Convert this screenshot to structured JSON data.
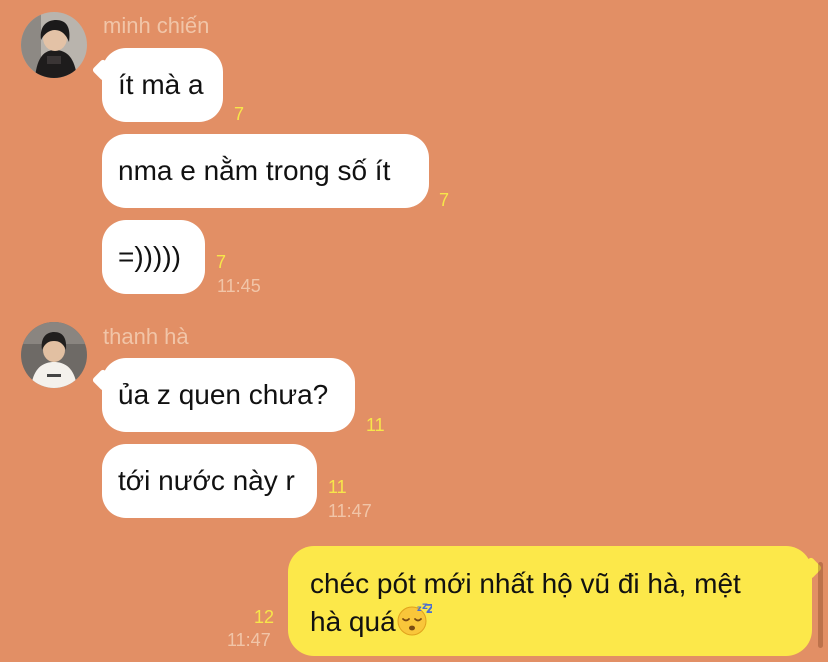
{
  "messages": [
    {
      "sender": "minh chiến",
      "avatar_icon": "user-avatar-minh-chien",
      "bubbles": [
        {
          "text": "ít mà a",
          "read_count": "7"
        },
        {
          "text": "nma e nằm trong số ít",
          "read_count": "7"
        },
        {
          "text": "=)))))",
          "read_count": "7",
          "time": "11:45"
        }
      ]
    },
    {
      "sender": "thanh hà",
      "avatar_icon": "user-avatar-thanh-ha",
      "bubbles": [
        {
          "text": "ủa z quen chưa?",
          "read_count": "11"
        },
        {
          "text": "tới nước này r",
          "read_count": "11",
          "time": "11:47"
        }
      ]
    }
  ],
  "my_message": {
    "line1": "chéc pót mới nhất hộ vũ đi hà, mệt",
    "line2": "hà quá",
    "emoji": "sleeping-face-emoji",
    "read_count": "12",
    "time": "11:47"
  },
  "colors": {
    "background": "#e28f65",
    "incoming_bubble": "#ffffff",
    "outgoing_bubble": "#fce84a",
    "read_count": "#f7e64a",
    "meta_text": "#f1c5a8"
  }
}
